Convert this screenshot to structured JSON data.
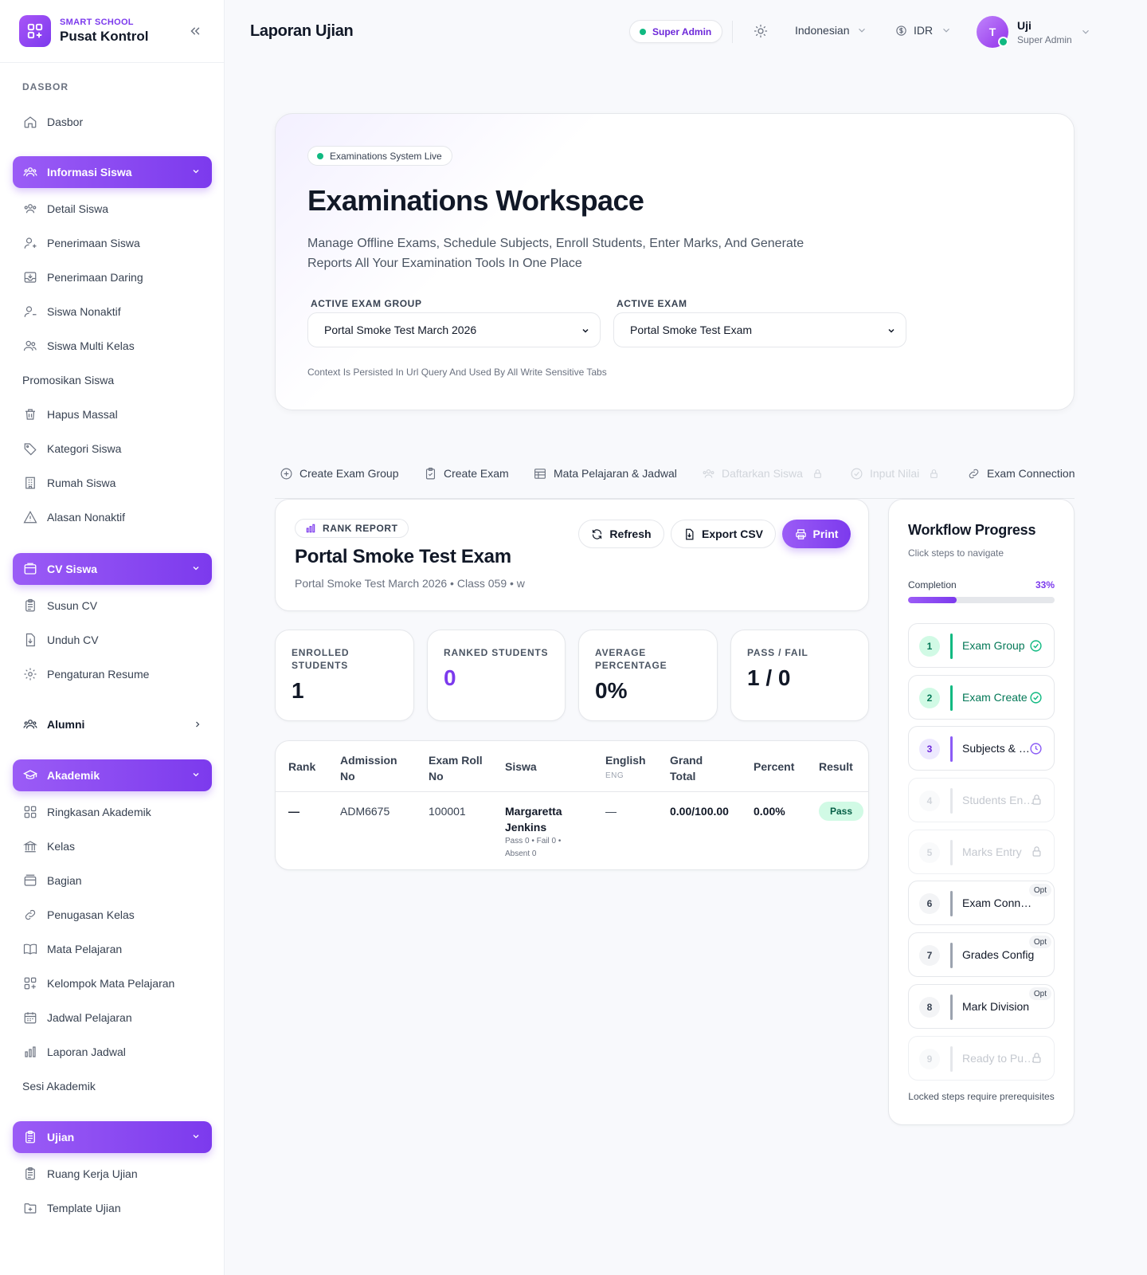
{
  "brand": {
    "sub": "SMART SCHOOL",
    "title": "Pusat Kontrol"
  },
  "sidebar": {
    "section_dasbor": "DASBOR",
    "dasbor": "Dasbor",
    "informasi_siswa": "Informasi Siswa",
    "siswa_items": [
      "Detail Siswa",
      "Penerimaan Siswa",
      "Penerimaan Daring",
      "Siswa Nonaktif",
      "Siswa Multi Kelas"
    ],
    "promosikan": "Promosikan Siswa",
    "siswa_items2": [
      "Hapus Massal",
      "Kategori Siswa",
      "Rumah Siswa",
      "Alasan Nonaktif"
    ],
    "cv_siswa": "CV Siswa",
    "cv_items": [
      "Susun CV",
      "Unduh CV",
      "Pengaturan Resume"
    ],
    "alumni": "Alumni",
    "akademik": "Akademik",
    "akademik_items": [
      "Ringkasan Akademik",
      "Kelas",
      "Bagian",
      "Penugasan Kelas",
      "Mata Pelajaran",
      "Kelompok Mata Pelajaran",
      "Jadwal Pelajaran",
      "Laporan Jadwal"
    ],
    "sesi": "Sesi Akademik",
    "ujian": "Ujian",
    "ujian_items": [
      "Ruang Kerja Ujian",
      "Template Ujian"
    ]
  },
  "topbar": {
    "title": "Laporan Ujian",
    "role_badge": "Super Admin",
    "language": "Indonesian",
    "currency": "IDR",
    "avatar_initial": "T",
    "user_name": "Uji",
    "user_role": "Super Admin"
  },
  "hero": {
    "live_label": "Examinations System Live",
    "title": "Examinations Workspace",
    "description": "Manage Offline Exams, Schedule Subjects, Enroll Students, Enter Marks, And Generate Reports All Your Examination Tools In One Place",
    "group_label": "ACTIVE EXAM GROUP",
    "group_value": "Portal Smoke Test March 2026",
    "exam_label": "ACTIVE EXAM",
    "exam_value": "Portal Smoke Test Exam",
    "note": "Context Is Persisted In Url Query And Used By All Write Sensitive Tabs"
  },
  "tabs": [
    "Create Exam Group",
    "Create Exam",
    "Mata Pelajaran & Jadwal",
    "Daftarkan Siswa",
    "Input Nilai",
    "Exam Connection"
  ],
  "report": {
    "badge": "RANK REPORT",
    "title": "Portal Smoke Test Exam",
    "meta": "Portal Smoke Test March 2026 • Class 059 • w",
    "refresh": "Refresh",
    "export": "Export CSV",
    "print": "Print"
  },
  "stats": [
    {
      "label": "ENROLLED STUDENTS",
      "value": "1"
    },
    {
      "label": "RANKED STUDENTS",
      "value": "0"
    },
    {
      "label": "AVERAGE PERCENTAGE",
      "value": "0%"
    },
    {
      "label": "PASS / FAIL",
      "value": "1 / 0"
    }
  ],
  "table": {
    "headers": {
      "rank": "Rank",
      "admission": "Admission No",
      "roll": "Exam Roll No",
      "siswa": "Siswa",
      "english": "English",
      "english_code": "ENG",
      "grand": "Grand Total",
      "percent": "Percent",
      "result": "Result"
    },
    "rows": [
      {
        "rank": "—",
        "admission": "ADM6675",
        "roll": "100001",
        "name": "Margaretta Jenkins",
        "summary": "Pass 0 • Fail 0 • Absent 0",
        "english": "—",
        "grand": "0.00/100.00",
        "percent": "0.00%",
        "result": "Pass"
      }
    ]
  },
  "workflow": {
    "title": "Workflow Progress",
    "subtitle": "Click steps to navigate",
    "completion_label": "Completion",
    "completion_pct": "33%",
    "completion_value": 33,
    "steps": [
      {
        "num": "1",
        "label": "Exam Group",
        "state": "done"
      },
      {
        "num": "2",
        "label": "Exam Create",
        "state": "done"
      },
      {
        "num": "3",
        "label": "Subjects & Schedule",
        "state": "current"
      },
      {
        "num": "4",
        "label": "Students Enroll",
        "state": "locked"
      },
      {
        "num": "5",
        "label": "Marks Entry",
        "state": "locked"
      },
      {
        "num": "6",
        "label": "Exam Connection",
        "state": "optional",
        "opt": "Opt"
      },
      {
        "num": "7",
        "label": "Grades Config",
        "state": "optional",
        "opt": "Opt"
      },
      {
        "num": "8",
        "label": "Mark Division",
        "state": "optional",
        "opt": "Opt"
      },
      {
        "num": "9",
        "label": "Ready to Publish",
        "state": "locked"
      }
    ],
    "footer": "Locked steps require prerequisites"
  },
  "colors": {
    "accent": "#7c3aed",
    "success": "#10b981"
  }
}
